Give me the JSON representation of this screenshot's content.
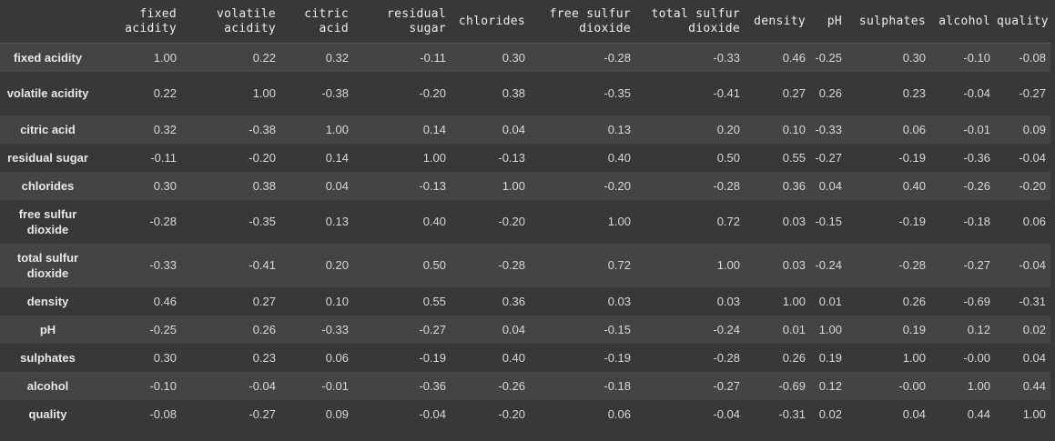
{
  "columns": [
    "fixed acidity",
    "volatile acidity",
    "citric acid",
    "residual sugar",
    "chlorides",
    "free sulfur dioxide",
    "total sulfur dioxide",
    "density",
    "pH",
    "sulphates",
    "alcohol",
    "quality"
  ],
  "rows": [
    {
      "label": "fixed acidity",
      "values": [
        "1.00",
        "0.22",
        "0.32",
        "-0.11",
        "0.30",
        "-0.28",
        "-0.33",
        "0.46",
        "-0.25",
        "0.30",
        "-0.10",
        "-0.08"
      ]
    },
    {
      "label": "volatile acidity",
      "values": [
        "0.22",
        "1.00",
        "-0.38",
        "-0.20",
        "0.38",
        "-0.35",
        "-0.41",
        "0.27",
        "0.26",
        "0.23",
        "-0.04",
        "-0.27"
      ]
    },
    {
      "label": "citric acid",
      "values": [
        "0.32",
        "-0.38",
        "1.00",
        "0.14",
        "0.04",
        "0.13",
        "0.20",
        "0.10",
        "-0.33",
        "0.06",
        "-0.01",
        "0.09"
      ]
    },
    {
      "label": "residual sugar",
      "values": [
        "-0.11",
        "-0.20",
        "0.14",
        "1.00",
        "-0.13",
        "0.40",
        "0.50",
        "0.55",
        "-0.27",
        "-0.19",
        "-0.36",
        "-0.04"
      ]
    },
    {
      "label": "chlorides",
      "values": [
        "0.30",
        "0.38",
        "0.04",
        "-0.13",
        "1.00",
        "-0.20",
        "-0.28",
        "0.36",
        "0.04",
        "0.40",
        "-0.26",
        "-0.20"
      ]
    },
    {
      "label": "free sulfur dioxide",
      "values": [
        "-0.28",
        "-0.35",
        "0.13",
        "0.40",
        "-0.20",
        "1.00",
        "0.72",
        "0.03",
        "-0.15",
        "-0.19",
        "-0.18",
        "0.06"
      ]
    },
    {
      "label": "total sulfur dioxide",
      "values": [
        "-0.33",
        "-0.41",
        "0.20",
        "0.50",
        "-0.28",
        "0.72",
        "1.00",
        "0.03",
        "-0.24",
        "-0.28",
        "-0.27",
        "-0.04"
      ]
    },
    {
      "label": "density",
      "values": [
        "0.46",
        "0.27",
        "0.10",
        "0.55",
        "0.36",
        "0.03",
        "0.03",
        "1.00",
        "0.01",
        "0.26",
        "-0.69",
        "-0.31"
      ]
    },
    {
      "label": "pH",
      "values": [
        "-0.25",
        "0.26",
        "-0.33",
        "-0.27",
        "0.04",
        "-0.15",
        "-0.24",
        "0.01",
        "1.00",
        "0.19",
        "0.12",
        "0.02"
      ]
    },
    {
      "label": "sulphates",
      "values": [
        "0.30",
        "0.23",
        "0.06",
        "-0.19",
        "0.40",
        "-0.19",
        "-0.28",
        "0.26",
        "0.19",
        "1.00",
        "-0.00",
        "0.04"
      ]
    },
    {
      "label": "alcohol",
      "values": [
        "-0.10",
        "-0.04",
        "-0.01",
        "-0.36",
        "-0.26",
        "-0.18",
        "-0.27",
        "-0.69",
        "0.12",
        "-0.00",
        "1.00",
        "0.44"
      ]
    },
    {
      "label": "quality",
      "values": [
        "-0.08",
        "-0.27",
        "0.09",
        "-0.04",
        "-0.20",
        "0.06",
        "-0.04",
        "-0.31",
        "0.02",
        "0.04",
        "0.44",
        "1.00"
      ]
    }
  ]
}
